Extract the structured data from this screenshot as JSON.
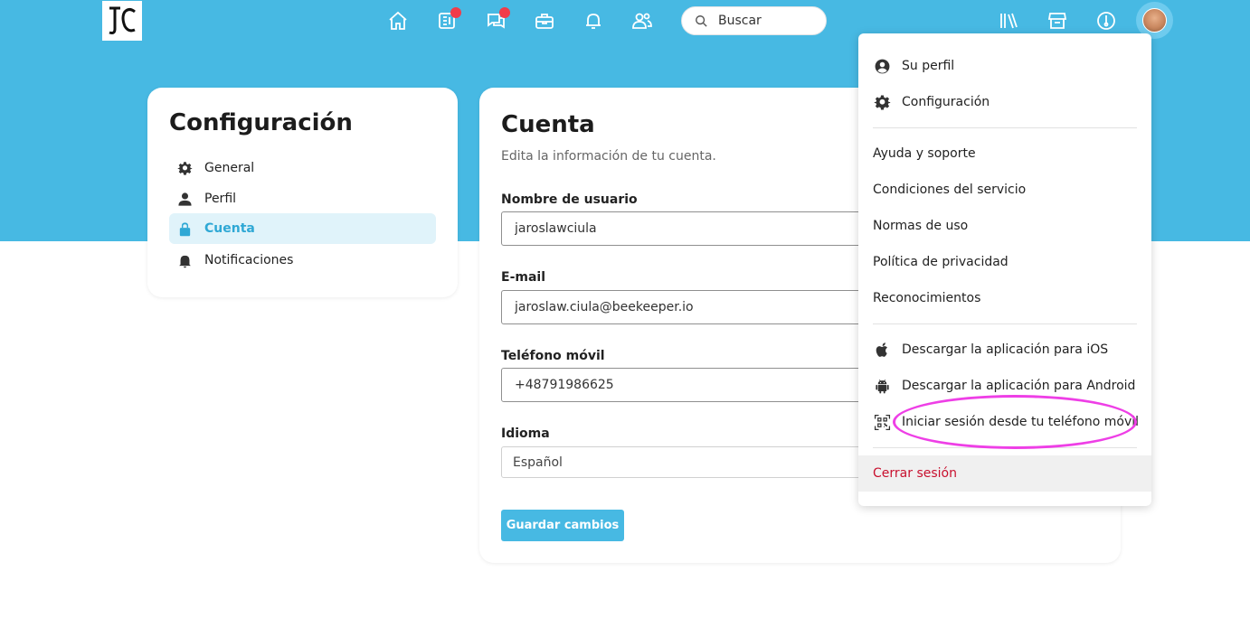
{
  "topbar": {
    "search_placeholder": "Buscar",
    "icons": [
      "home-icon",
      "news-icon",
      "chat-icon",
      "toolbox-icon",
      "bell-icon",
      "people-icon",
      "library-icon",
      "store-icon",
      "dashboard-icon"
    ],
    "accent": "#47b9e3",
    "badge_color": "#f03c4a"
  },
  "settings": {
    "title": "Configuración",
    "items": [
      {
        "label": "General",
        "icon": "gear-icon"
      },
      {
        "label": "Perfil",
        "icon": "user-icon"
      },
      {
        "label": "Cuenta",
        "icon": "lock-icon",
        "active": true
      },
      {
        "label": "Notificaciones",
        "icon": "bell-icon"
      }
    ]
  },
  "account": {
    "title": "Cuenta",
    "subtitle": "Edita la información de tu cuenta.",
    "username_label": "Nombre de usuario",
    "username_value": "jaroslawciula",
    "email_label": "E-mail",
    "email_value": "jaroslaw.ciula@beekeeper.io",
    "phone_label": "Teléfono móvil",
    "phone_value": "+48791986625",
    "language_label": "Idioma",
    "language_value": "Español",
    "save_label": "Guardar cambios"
  },
  "menu": {
    "profile": "Su perfil",
    "settings": "Configuración",
    "help": "Ayuda y soporte",
    "terms": "Condiciones del servicio",
    "rules": "Normas de uso",
    "privacy": "Política de privacidad",
    "credits": "Reconocimientos",
    "ios": "Descargar la aplicación para iOS",
    "android": "Descargar la aplicación para Android",
    "mobile_login": "Iniciar sesión desde tu teléfono móvil",
    "logout": "Cerrar sesión",
    "logout_color": "#c8102e",
    "highlight_color": "#ee3fe6"
  }
}
